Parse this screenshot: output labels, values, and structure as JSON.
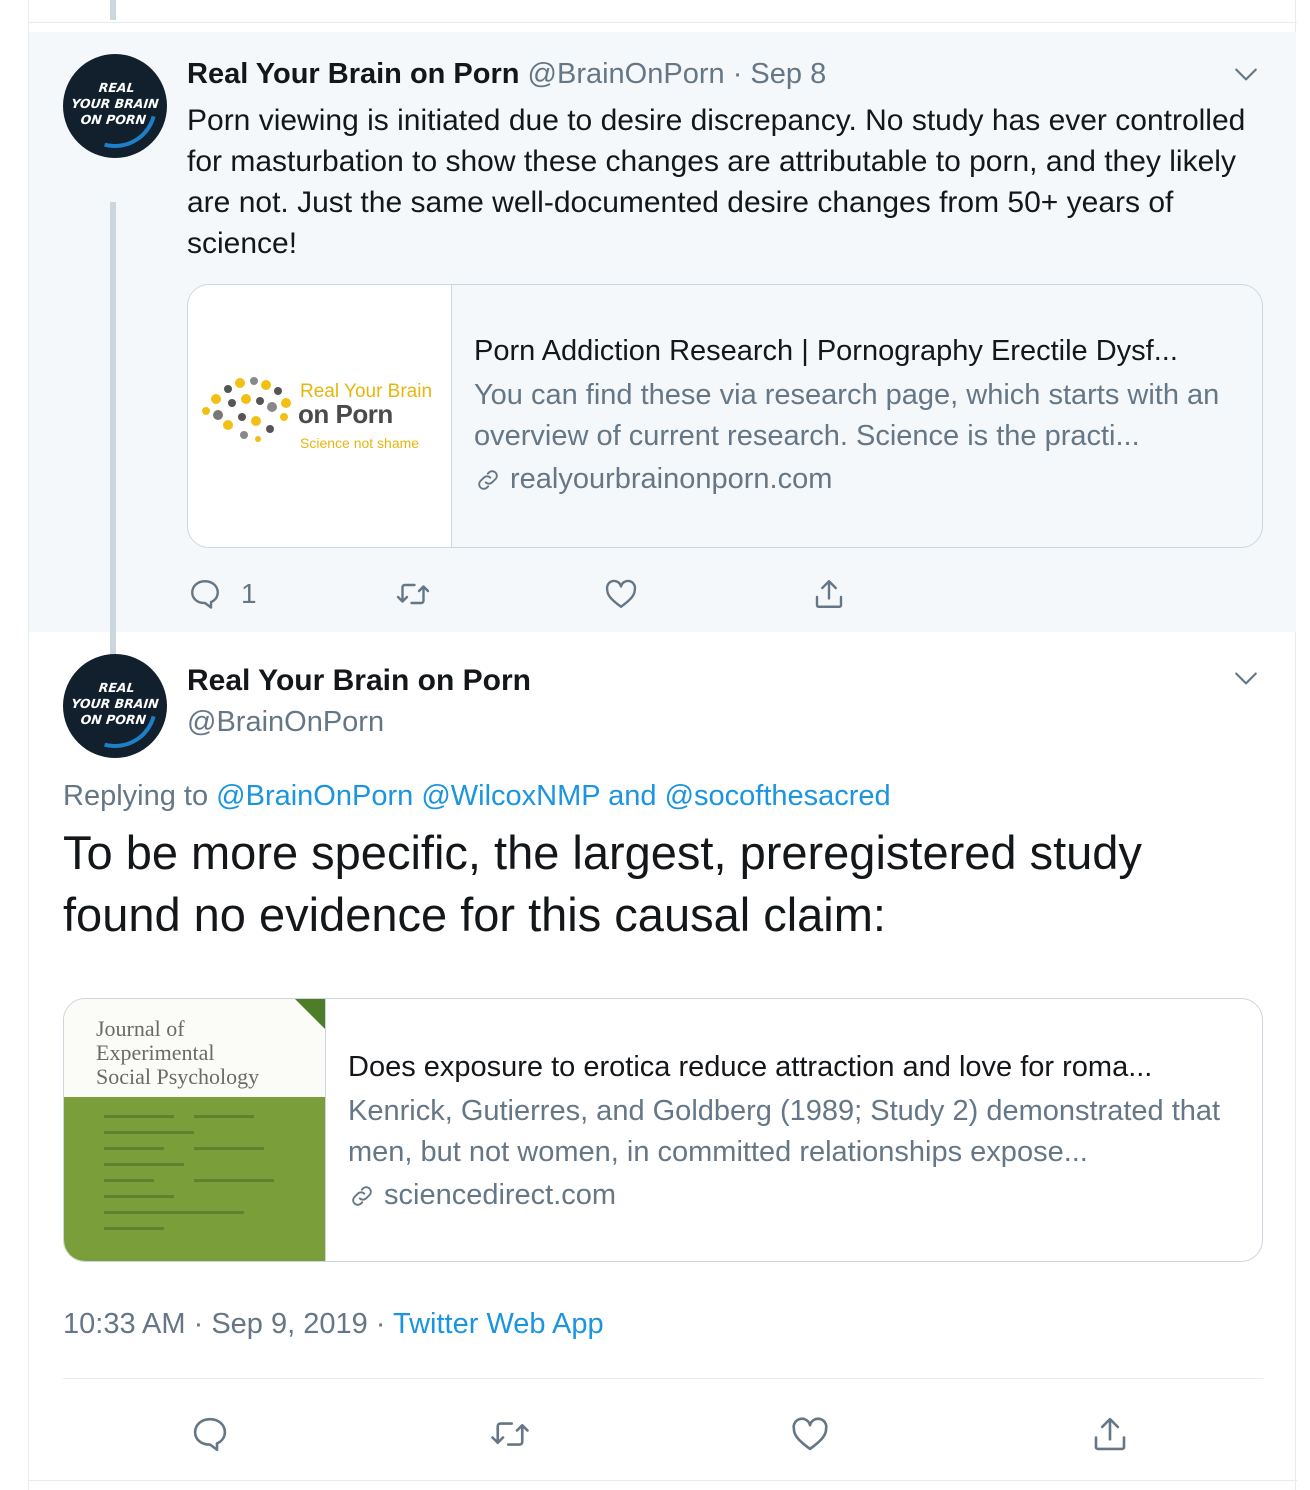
{
  "parent_tweet": {
    "display_name": "Real Your Brain on Porn",
    "handle": "@BrainOnPorn",
    "separator": " · ",
    "date": "Sep 8",
    "avatar_text": [
      "REAL",
      "YOUR BRAIN",
      "ON PORN"
    ],
    "text": "Porn viewing is initiated due to desire discrepancy. No study has ever controlled for masturbation to show these changes are attributable to porn, and they likely are not. Just the same well-documented desire changes from 50+ years of science!",
    "card": {
      "image_brand_line1": "Real Your Brain",
      "image_brand_line2": "on Porn",
      "image_brand_tagline": "Science not shame",
      "title": "Porn Addiction Research | Pornography Erectile Dysf...",
      "description": "You can find these via research page, which starts with an overview of current research. Science is the practi...",
      "domain": "realyourbrainonporn.com"
    },
    "actions": {
      "reply_count": "1",
      "retweet_count": "",
      "like_count": ""
    },
    "icons": [
      "chevron-down-icon",
      "reply-icon",
      "retweet-icon",
      "like-icon",
      "share-icon",
      "link-icon"
    ]
  },
  "focused_tweet": {
    "display_name": "Real Your Brain on Porn",
    "handle": "@BrainOnPorn",
    "avatar_text": [
      "REAL",
      "YOUR BRAIN",
      "ON PORN"
    ],
    "replying_prefix": "Replying to ",
    "replying_handle_1": "@BrainOnPorn",
    "replying_handle_2": "@WilcoxNMP",
    "replying_and": "and",
    "replying_handle_3": "@socofthesacred",
    "text": "To be more specific, the largest, preregistered study found no evidence for this causal claim:",
    "card": {
      "image_journal_line1": "Journal of",
      "image_journal_line2": "Experimental",
      "image_journal_line3": "Social Psychology",
      "title": "Does exposure to erotica reduce attraction and love for roma...",
      "description": "Kenrick, Gutierres, and Goldberg (1989; Study 2) demonstrated that men, but not women, in committed relationships expose...",
      "domain": "sciencedirect.com"
    },
    "time": "10:33 AM",
    "date": "Sep 9, 2019",
    "separator": " · ",
    "source": "Twitter Web App"
  },
  "colors": {
    "text": "#14171a",
    "muted": "#657786",
    "link": "#1b95e0",
    "highlight_bg": "#f5f8fa",
    "border": "#e6ecf0",
    "thread_line": "#ccd6dd"
  }
}
